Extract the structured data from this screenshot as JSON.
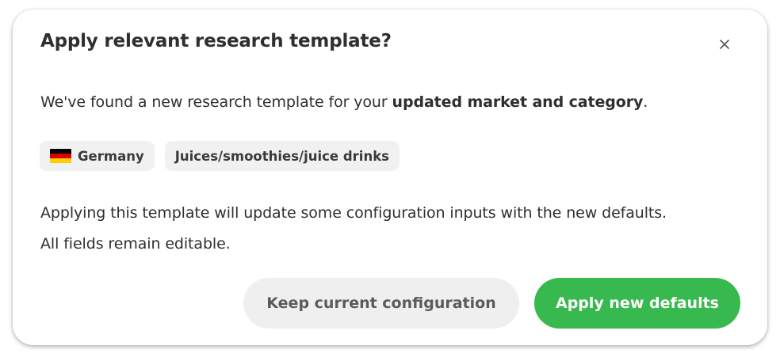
{
  "dialog": {
    "title": "Apply relevant research template?",
    "close_icon": "close-icon",
    "intro": {
      "text_before": "We've found a new research template for your ",
      "emphasis": "updated market and category",
      "text_after": "."
    },
    "tags": [
      {
        "label": "Germany",
        "icon": "germany-flag-icon",
        "flag_colors": [
          "#000000",
          "#dd0000",
          "#ffce00"
        ]
      },
      {
        "label": "Juices/smoothies/juice drinks"
      }
    ],
    "description": {
      "line1": "Applying this template will update some configuration inputs with the new defaults.",
      "line2": "All fields remain editable."
    },
    "buttons": {
      "keep_label": "Keep current configuration",
      "apply_label": "Apply new defaults"
    }
  },
  "colors": {
    "primary_button": "#38b94f",
    "secondary_button": "#efefef",
    "chip_background": "#f1f1f1"
  }
}
